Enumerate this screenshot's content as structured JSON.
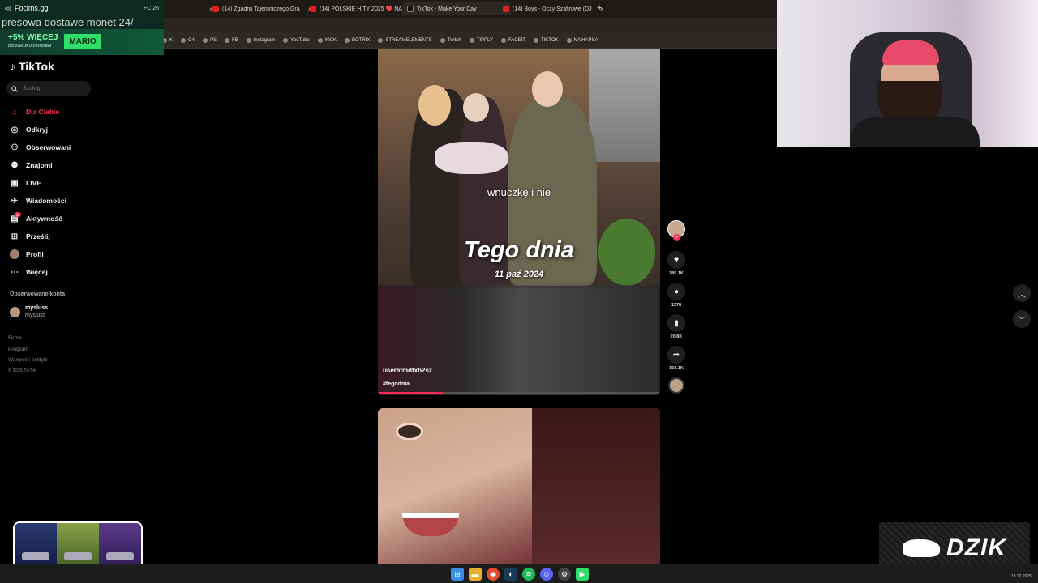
{
  "overlay": {
    "status_brand": "Focims.gg",
    "fps": "FC 26",
    "ticker": "presowa dostawe monet 24/",
    "promo_line1": "+5% WIĘCEJ",
    "promo_line2": "DO ZAKUPU Z KODEM",
    "promo_code": "MARIO"
  },
  "browser": {
    "tabs": [
      {
        "label": "(14) Zgadnij Tajemniczego Gra"
      },
      {
        "label": "(14) POLSKIE HITY 2025 ❤️ NA"
      },
      {
        "label": "TikTok - Make Your Day"
      },
      {
        "label": "(14) Boys - Oczy Szafirowe (DJ"
      }
    ],
    "new_tab": "+",
    "bookmarks": [
      "K",
      "G4",
      "PS",
      "FB",
      "Instagram",
      "YouTube",
      "KICK",
      "BOTRIX",
      "STREAMELEMENTS",
      "Twitch",
      "TIPPLY",
      "FACEIT",
      "TIKTOK",
      "NA HAPSA"
    ]
  },
  "tiktok": {
    "logo": "TikTok",
    "search_placeholder": "Szukaj",
    "nav": [
      {
        "label": "Dla Ciebie",
        "icon": "home-icon"
      },
      {
        "label": "Odkryj",
        "icon": "compass-icon"
      },
      {
        "label": "Obserwowani",
        "icon": "following-icon"
      },
      {
        "label": "Znajomi",
        "icon": "friends-icon"
      },
      {
        "label": "LIVE",
        "icon": "live-icon"
      },
      {
        "label": "Wiadomości",
        "icon": "messages-icon"
      },
      {
        "label": "Aktywność",
        "icon": "activity-icon"
      },
      {
        "label": "Prześlij",
        "icon": "upload-icon"
      },
      {
        "label": "Profil",
        "icon": "profile-avatar"
      },
      {
        "label": "Więcej",
        "icon": "more-icon"
      }
    ],
    "activity_badge": "99",
    "followed_title": "Obserwowane konta",
    "followed": [
      {
        "name": "mysluss",
        "handle": "mysluss"
      }
    ],
    "footer": [
      "Firma",
      "Program",
      "Warunki i polityki",
      "© 2025 TikTok"
    ]
  },
  "video": {
    "caption_small": "wnuczkę i nie",
    "caption_big": "Tego dnia",
    "caption_date": "11 paź 2024",
    "author": "user6tmdfxb2sz",
    "hashtag": "#tegodnia",
    "progress": 0.23,
    "likes": "189.1K",
    "comments": "1378",
    "saves": "20.8K",
    "shares": "158.1K"
  },
  "taskbar": {
    "date": "13.12.2025"
  },
  "brand": {
    "name": "DZIK"
  }
}
